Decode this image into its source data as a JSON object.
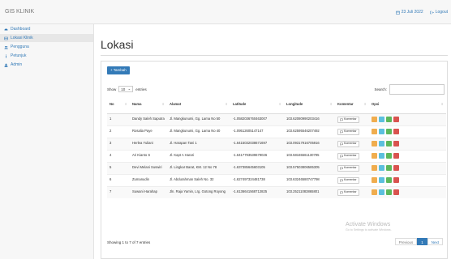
{
  "app": {
    "brand": "GIS KLINIK"
  },
  "topbar": {
    "date_label": "23 Juli 2022",
    "logout_label": "Logout"
  },
  "sidebar": {
    "items": [
      {
        "label": "Dashboard",
        "icon": "dashboard-icon"
      },
      {
        "label": "Lokasi Klinik",
        "icon": "table-icon"
      },
      {
        "label": "Pengguna",
        "icon": "users-icon"
      },
      {
        "label": "Petunjuk",
        "icon": "info-icon"
      },
      {
        "label": "Admin",
        "icon": "user-icon"
      }
    ]
  },
  "page": {
    "title": "Lokasi"
  },
  "toolbar": {
    "add_label": "+ Tambah"
  },
  "table_controls": {
    "show_label": "Show",
    "entries_value": "10",
    "entries_label": "entries",
    "search_label": "Search:"
  },
  "table": {
    "headers": [
      "No",
      "Nama",
      "Alamat",
      "Latitude",
      "Longitude",
      "Komentar",
      "Opsi"
    ],
    "comment_button_label": "Komentar",
    "rows": [
      {
        "no": "1",
        "nama": "Dandy Saleh Saputra",
        "alamat": "Jl. Mangkunumi, Gg. Lama No 50",
        "lat": "-1.0582036760463007",
        "lng": "103.62080990203416"
      },
      {
        "no": "2",
        "nama": "Rosalia Paye",
        "alamat": "Jl. Mangkunumi, Gg. Lama No 40",
        "lat": "-1.09512605147147",
        "lng": "103.62595546207492"
      },
      {
        "no": "3",
        "nama": "Herlea Yuliani",
        "alamat": "Jl. Harapan Tani 1",
        "lat": "-1.6415032038671697",
        "lng": "103.09317916705916"
      },
      {
        "no": "4",
        "nama": "Ari Kianto S",
        "alamat": "Jl. Kapt A Harari",
        "lat": "-1.6417793539679026",
        "lng": "103.58165561130795"
      },
      {
        "no": "5",
        "nama": "Devi Melani Suswiri",
        "alamat": "Jl. Lingkar Barat, KM. 12 No 78",
        "lat": "-1.637385645603105",
        "lng": "103.57503806585305"
      },
      {
        "no": "6",
        "nama": "Zumanudin",
        "alamat": "Jl. Abdurahman Saleh No. 32",
        "lat": "-1.627497324481738",
        "lng": "103.63246580747798"
      },
      {
        "no": "7",
        "nama": "Suwani Harahap",
        "alamat": "Jln. Raja Yamin, Lrg. Gotong Royong",
        "lat": "-1.6136641568712825",
        "lng": "103.25211083865801"
      }
    ]
  },
  "footer": {
    "info": "Showing 1 to 7 of 7 entries",
    "prev": "Previous",
    "page": "1",
    "next": "Next"
  },
  "watermark": {
    "line1": "Activate Windows",
    "line2": "Go to Settings to activate Windows."
  },
  "colors": {
    "primary": "#337ab7",
    "op_orange": "#f0ad4e",
    "op_cyan": "#5bc0de",
    "op_green": "#5cb85c",
    "op_red": "#d9534f"
  }
}
